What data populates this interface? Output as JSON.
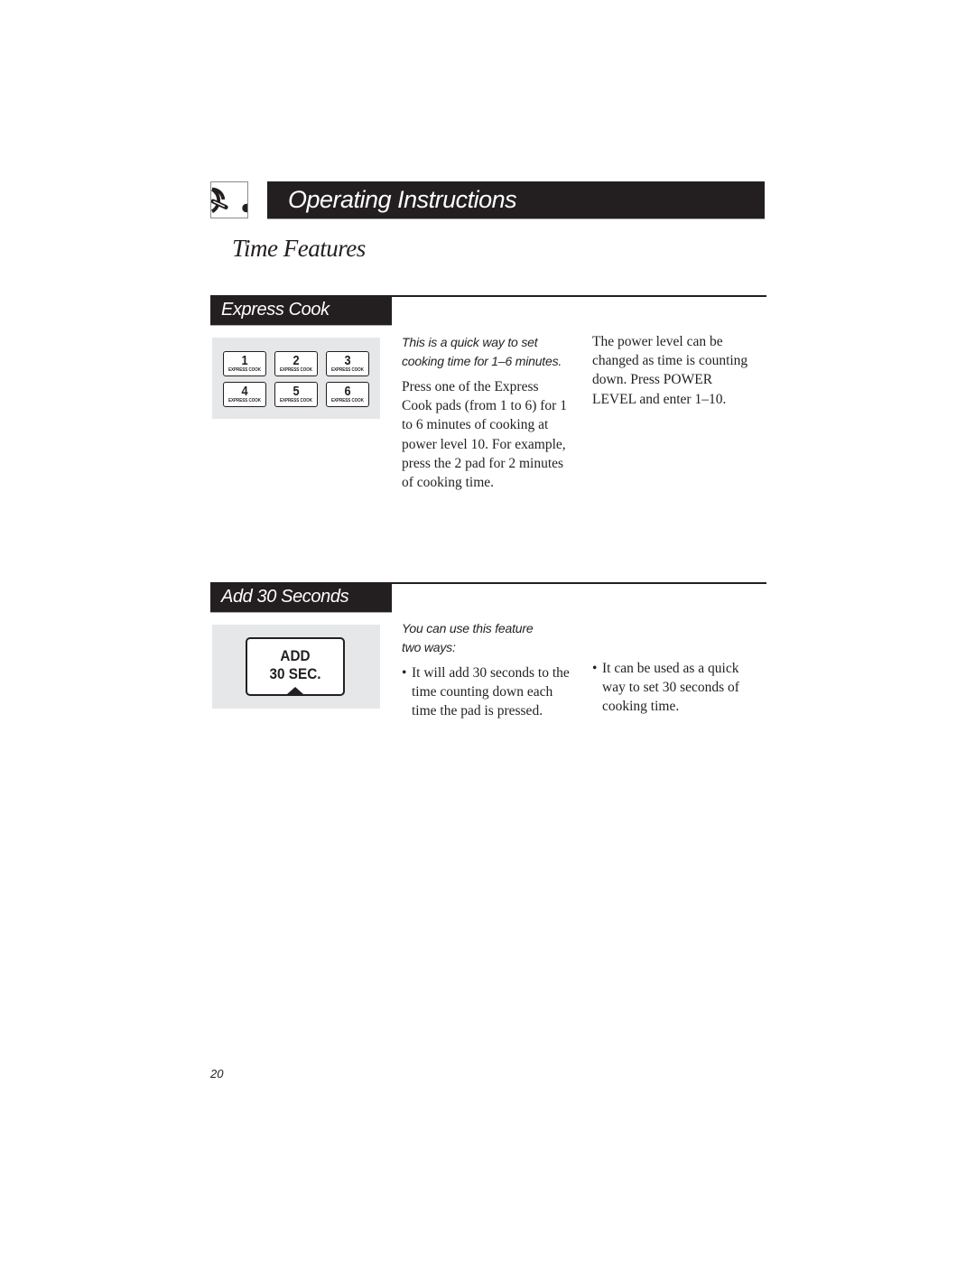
{
  "chapter": {
    "icon": "microwave-dial-icon",
    "title": "Operating Instructions"
  },
  "page_title": "Time Features",
  "sections": [
    {
      "label": "Express Cook",
      "pads": [
        {
          "number": "1",
          "label": "EXPRESS COOK"
        },
        {
          "number": "2",
          "label": "EXPRESS COOK"
        },
        {
          "number": "3",
          "label": "EXPRESS COOK"
        },
        {
          "number": "4",
          "label": "EXPRESS COOK"
        },
        {
          "number": "5",
          "label": "EXPRESS COOK"
        },
        {
          "number": "6",
          "label": "EXPRESS COOK"
        }
      ],
      "lead": "This is a quick way to set cooking time for 1–6 minutes.",
      "body": "Press one of the Express Cook pads (from 1 to 6) for 1 to 6 minutes of cooking at power level 10. For example, press the 2 pad for 2 minutes of cooking time.",
      "side_note": "The power level can be changed as time is counting down. Press POWER LEVEL and enter 1–10."
    },
    {
      "label": "Add 30 Seconds",
      "pad": {
        "line1": "ADD",
        "line2": "30 SEC."
      },
      "lead": "You can use this feature two ways:",
      "bullets": [
        "It will add 30 seconds to the time counting down each time the pad is pressed.",
        "It can be used as a quick way to set 30 seconds of cooking time."
      ]
    }
  ],
  "page_number": "20"
}
